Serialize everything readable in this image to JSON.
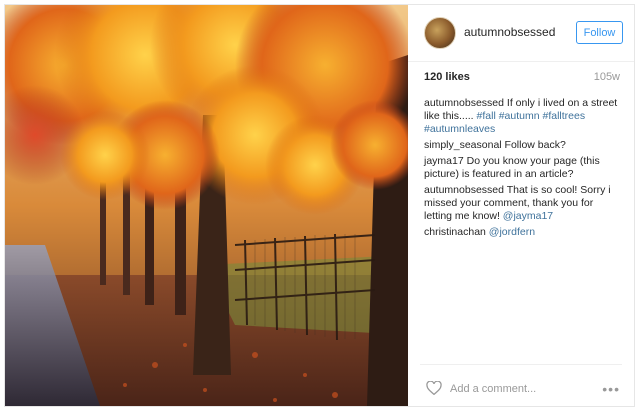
{
  "post": {
    "username": "autumnobsessed",
    "follow_label": "Follow",
    "likes": "120 likes",
    "age": "105w",
    "add_comment_placeholder": "Add a comment...",
    "more_label": "•••"
  },
  "comments": [
    {
      "author": "autumnobsessed",
      "text": "If only i lived on a street like this..... ",
      "highlight": "#fall #autumn #falltrees #autumnleaves"
    },
    {
      "author": "simply_seasonal",
      "text": "Follow back?",
      "highlight": ""
    },
    {
      "author": "jayma17",
      "text": "Do you know your page (this picture) is featured in an article?",
      "highlight": ""
    },
    {
      "author": "autumnobsessed",
      "text": "That is so cool! Sorry i missed your comment, thank you for letting me know! ",
      "highlight": "@jayma17"
    },
    {
      "author": "christinachan",
      "text": "",
      "highlight": "@jordfern"
    }
  ],
  "colors": {
    "accent": "#3897f0",
    "link": "#3f729b"
  }
}
